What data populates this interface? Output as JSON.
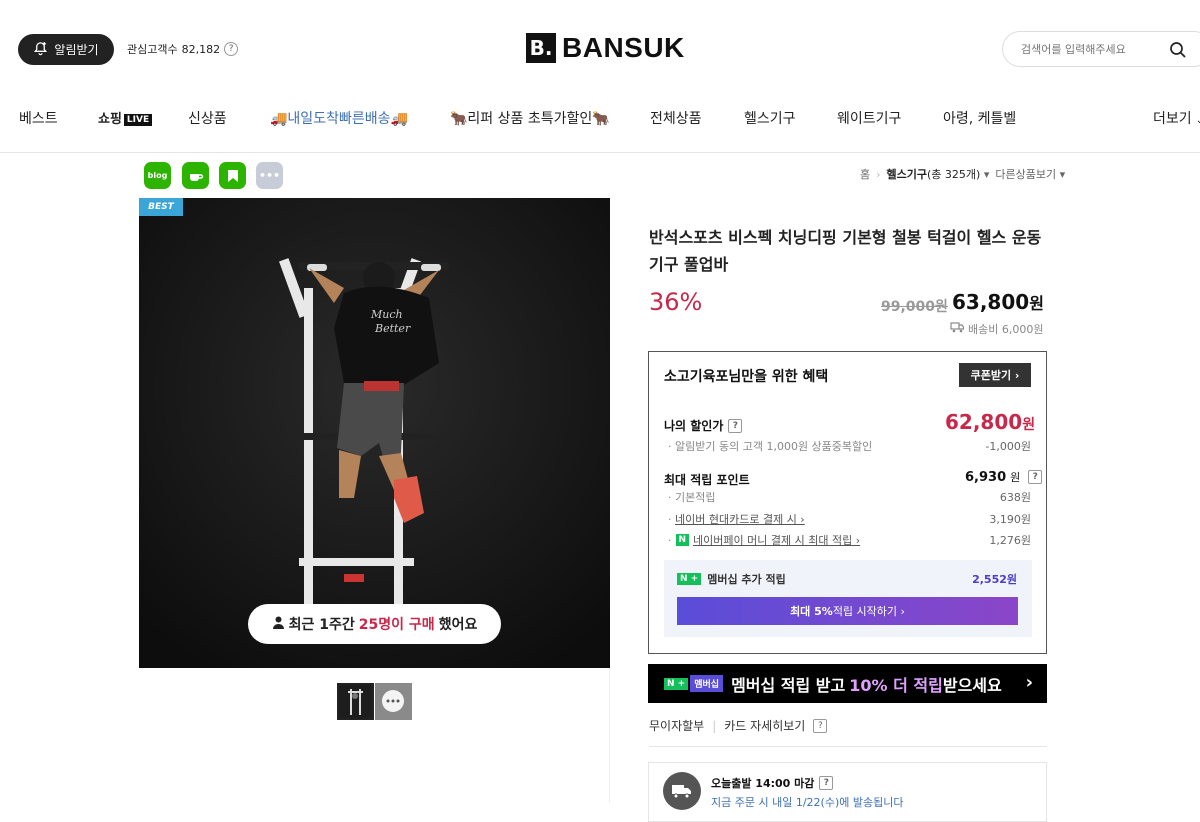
{
  "header": {
    "alarm_label": "알림받기",
    "watchers_label": "관심고객수",
    "watchers_count": "82,182",
    "help": "?",
    "logo_mark": "B.",
    "logo_text": "BANSUK",
    "search_placeholder": "검색어를 입력해주세요"
  },
  "nav": {
    "items": [
      "베스트",
      "쇼핑",
      "신상품",
      "🚚내일도착빠른배송🚚",
      "🐂리퍼 상품 초특가할인🐂",
      "전체상품",
      "헬스기구",
      "웨이트기구",
      "아령, 케틀벨",
      "더보기"
    ],
    "live_badge": "LIVE"
  },
  "share": {
    "blog": "blog",
    "more": "•••"
  },
  "breadcrumb": {
    "home": "홈",
    "category": "헬스기구",
    "count": "(총 325개)",
    "other": "다른상품보기"
  },
  "product": {
    "best_tag": "BEST",
    "recent_prefix": "최근 1주간",
    "recent_count": "25명이 구매",
    "recent_suffix": "했어요",
    "shirt_text": "Much Better",
    "title": "반석스포츠 비스펙 치닝디핑 기본형 철봉 턱걸이 헬스 운동 기구 풀업바",
    "discount": "36%",
    "original_price": "99,000원",
    "sale_price_num": "63,800",
    "won": "원",
    "shipping": "배송비 6,000원"
  },
  "benefit": {
    "title": "소고기육포님만을 위한 혜택",
    "coupon_button": "쿠폰받기 ›",
    "my_price_label": "나의 할인가",
    "my_price_num": "62,800",
    "my_price_unit": "원",
    "my_price_sub": "알림받기 동의 고객 1,000원 상품중복할인",
    "my_price_sub_val": "-1,000원",
    "points_label": "최대 적립 포인트",
    "points_total": "6,930",
    "points_unit": "원",
    "basic_label": "기본적립",
    "basic_val": "638원",
    "card_label": "네이버 현대카드로 결제 시 ›",
    "card_val": "3,190원",
    "npay_label": "네이버페이 머니 결제 시 최대 적립 ›",
    "npay_val": "1,276원",
    "member_label": "멤버십 추가 적립",
    "member_val": "2,552원",
    "member_start_prefix": "최대 5%",
    "member_start_suffix": " 적립 시작하기 ›"
  },
  "banner": {
    "badge": "멤버십",
    "text_a": "멤버십 적립 받고 ",
    "text_b": "10% 더 적립",
    "text_c": " 받으세요",
    "arrow": "›"
  },
  "installment": {
    "label1": "무이자할부",
    "label2": "카드 자세히보기"
  },
  "delivery": {
    "title": "오늘출발 14:00 마감",
    "sub": "지금 주문 시 내일 1/22(수)에 발송됩니다"
  },
  "colors": {
    "accent_red": "#c8294b",
    "naver_green": "#13c05a",
    "member_purple": "#7a4ad0"
  }
}
